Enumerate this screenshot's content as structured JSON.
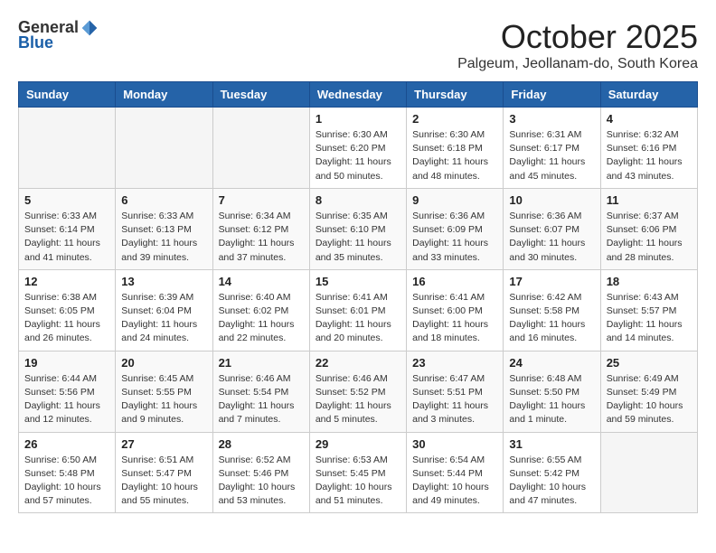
{
  "header": {
    "logo_general": "General",
    "logo_blue": "Blue",
    "month_title": "October 2025",
    "location": "Palgeum, Jeollanam-do, South Korea"
  },
  "weekdays": [
    "Sunday",
    "Monday",
    "Tuesday",
    "Wednesday",
    "Thursday",
    "Friday",
    "Saturday"
  ],
  "weeks": [
    [
      {
        "day": "",
        "info": ""
      },
      {
        "day": "",
        "info": ""
      },
      {
        "day": "",
        "info": ""
      },
      {
        "day": "1",
        "info": "Sunrise: 6:30 AM\nSunset: 6:20 PM\nDaylight: 11 hours\nand 50 minutes."
      },
      {
        "day": "2",
        "info": "Sunrise: 6:30 AM\nSunset: 6:18 PM\nDaylight: 11 hours\nand 48 minutes."
      },
      {
        "day": "3",
        "info": "Sunrise: 6:31 AM\nSunset: 6:17 PM\nDaylight: 11 hours\nand 45 minutes."
      },
      {
        "day": "4",
        "info": "Sunrise: 6:32 AM\nSunset: 6:16 PM\nDaylight: 11 hours\nand 43 minutes."
      }
    ],
    [
      {
        "day": "5",
        "info": "Sunrise: 6:33 AM\nSunset: 6:14 PM\nDaylight: 11 hours\nand 41 minutes."
      },
      {
        "day": "6",
        "info": "Sunrise: 6:33 AM\nSunset: 6:13 PM\nDaylight: 11 hours\nand 39 minutes."
      },
      {
        "day": "7",
        "info": "Sunrise: 6:34 AM\nSunset: 6:12 PM\nDaylight: 11 hours\nand 37 minutes."
      },
      {
        "day": "8",
        "info": "Sunrise: 6:35 AM\nSunset: 6:10 PM\nDaylight: 11 hours\nand 35 minutes."
      },
      {
        "day": "9",
        "info": "Sunrise: 6:36 AM\nSunset: 6:09 PM\nDaylight: 11 hours\nand 33 minutes."
      },
      {
        "day": "10",
        "info": "Sunrise: 6:36 AM\nSunset: 6:07 PM\nDaylight: 11 hours\nand 30 minutes."
      },
      {
        "day": "11",
        "info": "Sunrise: 6:37 AM\nSunset: 6:06 PM\nDaylight: 11 hours\nand 28 minutes."
      }
    ],
    [
      {
        "day": "12",
        "info": "Sunrise: 6:38 AM\nSunset: 6:05 PM\nDaylight: 11 hours\nand 26 minutes."
      },
      {
        "day": "13",
        "info": "Sunrise: 6:39 AM\nSunset: 6:04 PM\nDaylight: 11 hours\nand 24 minutes."
      },
      {
        "day": "14",
        "info": "Sunrise: 6:40 AM\nSunset: 6:02 PM\nDaylight: 11 hours\nand 22 minutes."
      },
      {
        "day": "15",
        "info": "Sunrise: 6:41 AM\nSunset: 6:01 PM\nDaylight: 11 hours\nand 20 minutes."
      },
      {
        "day": "16",
        "info": "Sunrise: 6:41 AM\nSunset: 6:00 PM\nDaylight: 11 hours\nand 18 minutes."
      },
      {
        "day": "17",
        "info": "Sunrise: 6:42 AM\nSunset: 5:58 PM\nDaylight: 11 hours\nand 16 minutes."
      },
      {
        "day": "18",
        "info": "Sunrise: 6:43 AM\nSunset: 5:57 PM\nDaylight: 11 hours\nand 14 minutes."
      }
    ],
    [
      {
        "day": "19",
        "info": "Sunrise: 6:44 AM\nSunset: 5:56 PM\nDaylight: 11 hours\nand 12 minutes."
      },
      {
        "day": "20",
        "info": "Sunrise: 6:45 AM\nSunset: 5:55 PM\nDaylight: 11 hours\nand 9 minutes."
      },
      {
        "day": "21",
        "info": "Sunrise: 6:46 AM\nSunset: 5:54 PM\nDaylight: 11 hours\nand 7 minutes."
      },
      {
        "day": "22",
        "info": "Sunrise: 6:46 AM\nSunset: 5:52 PM\nDaylight: 11 hours\nand 5 minutes."
      },
      {
        "day": "23",
        "info": "Sunrise: 6:47 AM\nSunset: 5:51 PM\nDaylight: 11 hours\nand 3 minutes."
      },
      {
        "day": "24",
        "info": "Sunrise: 6:48 AM\nSunset: 5:50 PM\nDaylight: 11 hours\nand 1 minute."
      },
      {
        "day": "25",
        "info": "Sunrise: 6:49 AM\nSunset: 5:49 PM\nDaylight: 10 hours\nand 59 minutes."
      }
    ],
    [
      {
        "day": "26",
        "info": "Sunrise: 6:50 AM\nSunset: 5:48 PM\nDaylight: 10 hours\nand 57 minutes."
      },
      {
        "day": "27",
        "info": "Sunrise: 6:51 AM\nSunset: 5:47 PM\nDaylight: 10 hours\nand 55 minutes."
      },
      {
        "day": "28",
        "info": "Sunrise: 6:52 AM\nSunset: 5:46 PM\nDaylight: 10 hours\nand 53 minutes."
      },
      {
        "day": "29",
        "info": "Sunrise: 6:53 AM\nSunset: 5:45 PM\nDaylight: 10 hours\nand 51 minutes."
      },
      {
        "day": "30",
        "info": "Sunrise: 6:54 AM\nSunset: 5:44 PM\nDaylight: 10 hours\nand 49 minutes."
      },
      {
        "day": "31",
        "info": "Sunrise: 6:55 AM\nSunset: 5:42 PM\nDaylight: 10 hours\nand 47 minutes."
      },
      {
        "day": "",
        "info": ""
      }
    ]
  ]
}
